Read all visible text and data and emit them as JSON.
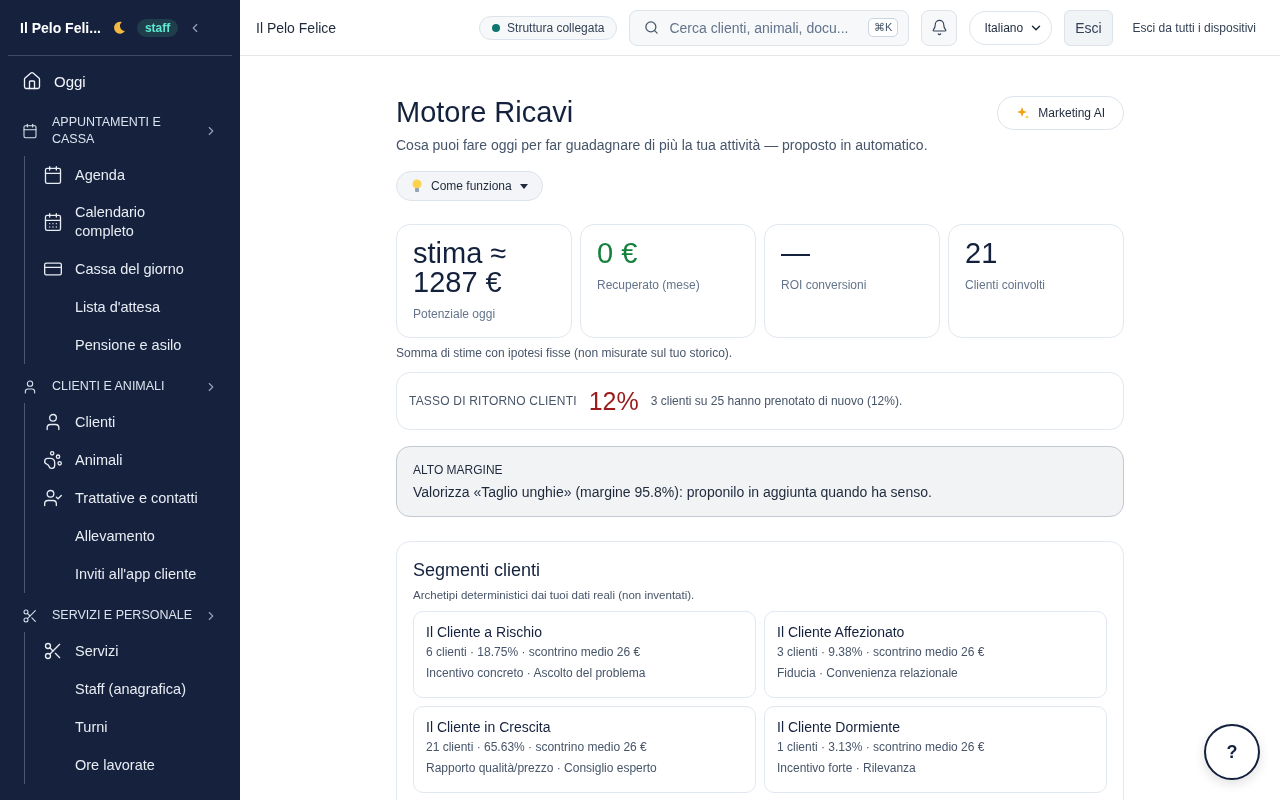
{
  "sidebar": {
    "brand": "Il Pelo Feli...",
    "badge": "staff",
    "items": [
      {
        "kind": "link",
        "label": "Oggi"
      },
      {
        "kind": "section",
        "label": "APPUNTAMENTI E CASSA",
        "children": [
          {
            "label": "Agenda"
          },
          {
            "label": "Calendario completo"
          },
          {
            "label": "Cassa del giorno"
          },
          {
            "label": "Lista d'attesa"
          },
          {
            "label": "Pensione e asilo"
          }
        ]
      },
      {
        "kind": "section",
        "label": "CLIENTI E ANIMALI",
        "children": [
          {
            "label": "Clienti"
          },
          {
            "label": "Animali"
          },
          {
            "label": "Trattative e contatti"
          },
          {
            "label": "Allevamento"
          },
          {
            "label": "Inviti all'app cliente"
          }
        ]
      },
      {
        "kind": "section",
        "label": "SERVIZI E PERSONALE",
        "children": [
          {
            "label": "Servizi"
          },
          {
            "label": "Staff (anagrafica)"
          },
          {
            "label": "Turni"
          },
          {
            "label": "Ore lavorate"
          }
        ]
      }
    ]
  },
  "topbar": {
    "title": "Il Pelo Felice",
    "status": {
      "label": "Struttura collegata",
      "connected": true
    },
    "search": {
      "placeholder": "Cerca clienti, animali, docu...",
      "shortcut": "⌘K"
    },
    "language": "Italiano",
    "logout": "Esci",
    "logout_all": "Esci da tutti i dispositivi"
  },
  "page": {
    "title": "Motore Ricavi",
    "subtitle": "Cosa puoi fare oggi per far guadagnare di più la tua attività — proposto in automatico.",
    "action": "Marketing AI",
    "how": "Come funziona",
    "stats": [
      {
        "value": "stima ≈ 1287 €",
        "label": "Potenziale oggi",
        "color": "#14213d"
      },
      {
        "value": "0 €",
        "label": "Recuperato (mese)",
        "color": "#15803d"
      },
      {
        "value": "—",
        "label": "ROI conversioni",
        "color": "#14213d"
      },
      {
        "value": "21",
        "label": "Clienti coinvolti",
        "color": "#14213d"
      }
    ],
    "stats_note": "Somma di stime con ipotesi fisse (non misurate sul tuo storico).",
    "return_rate": {
      "label": "TASSO DI RITORNO CLIENTI",
      "value": "12%",
      "detail": "3 clienti su 25 hanno prenotato di nuovo (12%)."
    },
    "insight": {
      "label": "ALTO MARGINE",
      "text": "Valorizza «Taglio unghie» (margine 95.8%): proponilo in aggiunta quando ha senso."
    },
    "segments": {
      "title": "Segmenti clienti",
      "subtitle": "Archetipi deterministici dai tuoi dati reali (non inventati).",
      "items": [
        {
          "name": "Il Cliente a Rischio",
          "stats": "6 clienti · 18.75% · scontrino medio 26 €",
          "levers": "Incentivo concreto · Ascolto del problema"
        },
        {
          "name": "Il Cliente Affezionato",
          "stats": "3 clienti · 9.38% · scontrino medio 26 €",
          "levers": "Fiducia · Convenienza relazionale"
        },
        {
          "name": "Il Cliente in Crescita",
          "stats": "21 clienti · 65.63% · scontrino medio 26 €",
          "levers": "Rapporto qualità/prezzo · Consiglio esperto"
        },
        {
          "name": "Il Cliente Dormiente",
          "stats": "1 clienti · 3.13% · scontrino medio 26 €",
          "levers": "Incentivo forte · Rilevanza"
        }
      ]
    }
  },
  "help": "?"
}
